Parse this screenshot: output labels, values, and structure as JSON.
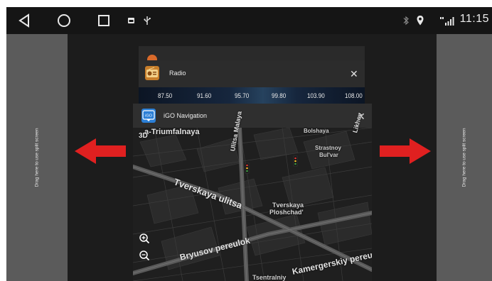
{
  "status_bar": {
    "time": "11:15",
    "nav_icons": [
      "back-icon",
      "home-icon",
      "recent-apps-icon"
    ],
    "left_icons": [
      "gallery-icon",
      "usb-icon"
    ],
    "right_icons": [
      "bluetooth-icon",
      "location-icon",
      "signal-icon"
    ]
  },
  "split_hint": {
    "left_text": "Drag here to use split screen",
    "right_text": "Drag here to use split screen"
  },
  "recent_apps": [
    {
      "title": "Radio",
      "frequencies": [
        "87.50",
        "91.60",
        "95.70",
        "99.80",
        "103.90",
        "108.00"
      ]
    },
    {
      "title": "iGO Navigation",
      "icon_text": "iGO",
      "map": {
        "mode_badge": "3D",
        "labels": {
          "top_street": "a-Triumfalnaya",
          "tverskaya_street": "Tverskaya ulitsa",
          "malaya": "Ulitsa Malaya",
          "bolshaya": "Bolshaya",
          "strastnoy_1": "Strastnoy",
          "strastnoy_2": "Bul'var",
          "square_1": "Tverskaya",
          "square_2": "Ploshchad'",
          "bryusov": "Bryusov pereulok",
          "kamergerskiy": "Kamergerskiy pereul",
          "likhov": "Likhov",
          "bottom": "Tsentralniy"
        }
      }
    }
  ],
  "colors": {
    "arrow": "#e02020",
    "split_zone": "#5b5b5b",
    "igo_icon": "#2b7fd6",
    "radio_icon": "#c77e2b"
  }
}
